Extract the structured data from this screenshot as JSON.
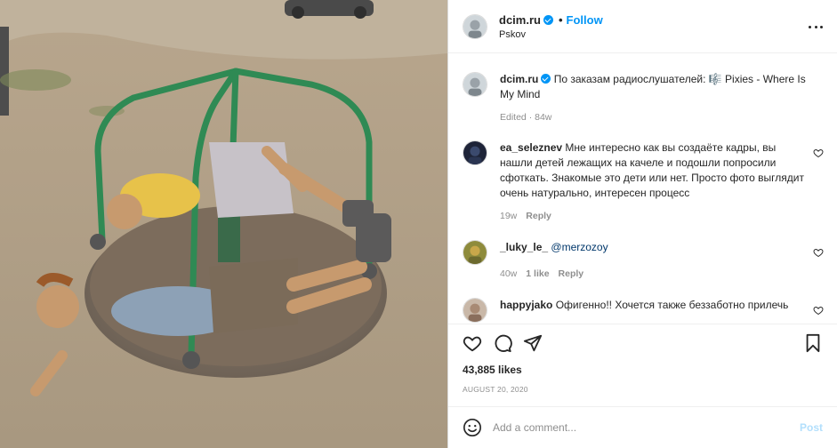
{
  "post": {
    "username": "dcim.ru",
    "follow_label": "Follow",
    "location": "Pskov",
    "caption": "По заказам радиослушателей: 🎼 Pixies - Where Is My Mind",
    "caption_meta": "Edited · 84w"
  },
  "comments": [
    {
      "username": "ea_seleznev",
      "text": "Мне интересно как вы создаёте кадры, вы нашли детей лежащих на качеле и подошли попросили сфоткать. Знакомые это дети или нет. Просто фото выглядит очень натурально, интересен процесс",
      "time": "19w",
      "reply_label": "Reply"
    },
    {
      "username": "_luky_le_",
      "text": "@merzozoy",
      "time": "40w",
      "likes": "1 like",
      "reply_label": "Reply"
    },
    {
      "username": "happyjako",
      "text": "Офигенно!! Хочется также беззаботно прилечь"
    }
  ],
  "likes": "43,885 likes",
  "date": "AUGUST 20, 2020",
  "add_comment": {
    "placeholder": "Add a comment...",
    "post_label": "Post"
  },
  "colors": {
    "accent": "#0095f6",
    "post_disabled": "#b2dffc",
    "secondary_text": "#8e8e8e",
    "mention": "#00376b"
  },
  "icons": [
    "more-options-icon",
    "verified-badge-icon",
    "heart-icon",
    "comment-icon",
    "share-icon",
    "save-icon",
    "emoji-icon"
  ]
}
